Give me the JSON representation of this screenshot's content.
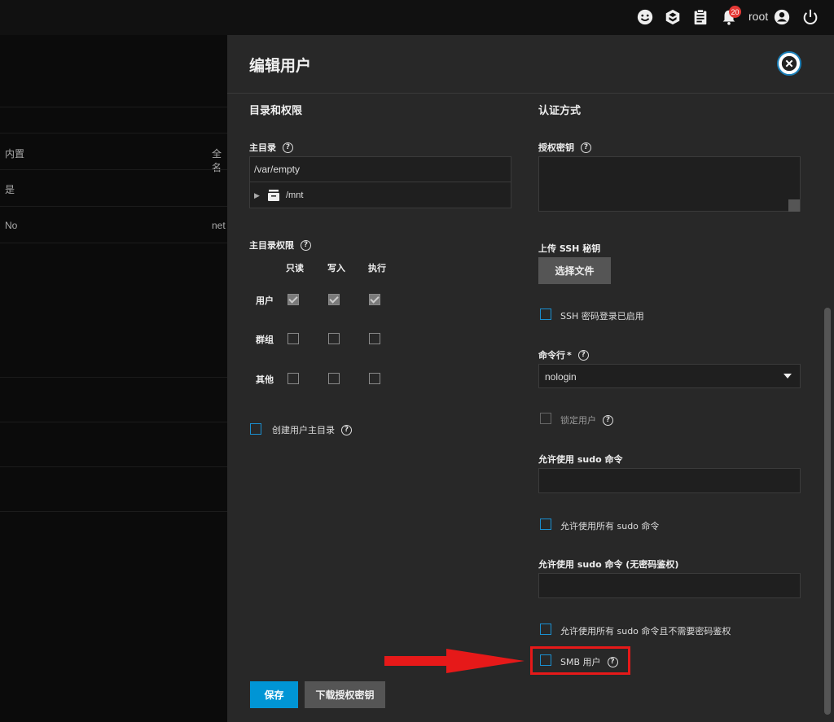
{
  "topbar": {
    "notification_count": "20",
    "username": "root",
    "icons": [
      "feedback-icon",
      "truecommand-icon",
      "clipboard-icon",
      "bell-icon",
      "account-icon",
      "power-icon"
    ]
  },
  "background_table": {
    "col_builtin": "内置",
    "col_fullname": "全名",
    "row1_builtin": "是",
    "row2_builtin": "No",
    "row2_fullname": "net"
  },
  "panel": {
    "title": "编辑用户",
    "left": {
      "section_title": "目录和权限",
      "home_dir_label": "主目录",
      "home_dir_value": "/var/empty",
      "tree_item": "/mnt",
      "home_perm_label": "主目录权限",
      "perm_headers": [
        "只读",
        "写入",
        "执行"
      ],
      "perm_rows": [
        "用户",
        "群组",
        "其他"
      ],
      "create_home_label": "创建用户主目录"
    },
    "right": {
      "section_title": "认证方式",
      "auth_key_label": "授权密钥",
      "upload_ssh_label": "上传 SSH 秘钥",
      "choose_file_label": "选择文件",
      "ssh_password_label": "SSH 密码登录已启用",
      "shell_label": "命令行",
      "shell_required": "*",
      "shell_value": "nologin",
      "lock_user_label": "锁定用户",
      "sudo_label": "允许使用 sudo 命令",
      "sudo_all_label": "允许使用所有 sudo 命令",
      "sudo_nopass_label": "允许使用 sudo 命令 (无密码鉴权)",
      "sudo_all_nopass_label": "允许使用所有 sudo 命令且不需要密码鉴权",
      "smb_user_label": "SMB 用户"
    },
    "buttons": {
      "save": "保存",
      "download_key": "下载授权密钥"
    }
  },
  "colors": {
    "accent": "#0095d5",
    "highlight": "#e61919",
    "panel_bg": "#282828"
  }
}
